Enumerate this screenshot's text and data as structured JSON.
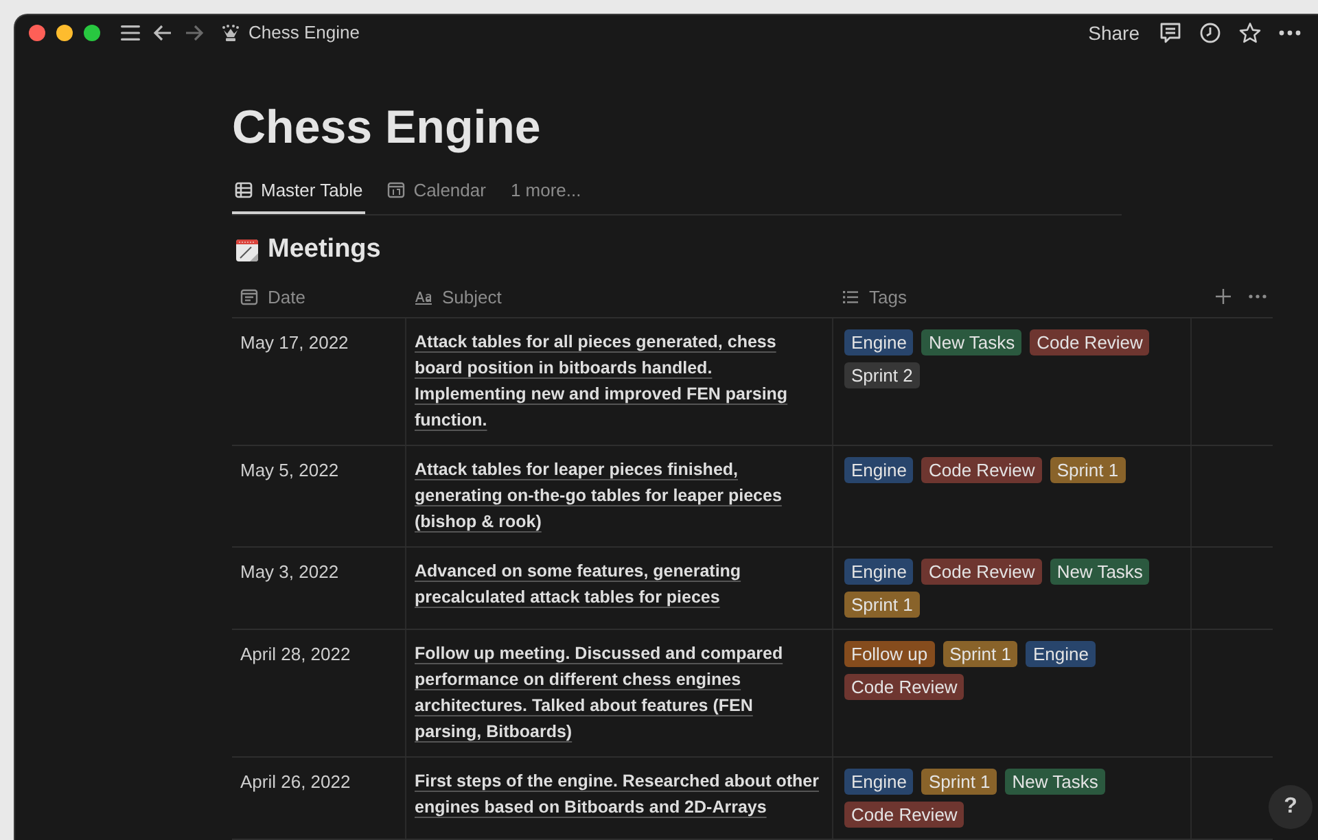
{
  "window": {
    "title": "Chess Engine",
    "actions": [
      "Share"
    ]
  },
  "page": {
    "title": "Chess Engine"
  },
  "views": [
    {
      "label": "Master Table",
      "selected": true
    },
    {
      "label": "Calendar",
      "selected": false
    },
    {
      "label": "1 more...",
      "selected": false
    }
  ],
  "database": {
    "title": "Meetings",
    "columns": [
      {
        "label": "Date"
      },
      {
        "label": "Subject"
      },
      {
        "label": "Tags"
      }
    ],
    "rows": [
      {
        "date": "May 17, 2022",
        "subject": "Attack tables for all pieces generated, chess board position in bitboards handled. Implementing new and improved FEN parsing function.",
        "tags": [
          {
            "label": "Engine",
            "color": "#28456c"
          },
          {
            "label": "New Tasks",
            "color": "#2b593f"
          },
          {
            "label": "Code Review",
            "color": "#6e3630"
          },
          {
            "label": "Sprint 2",
            "color": "#373737"
          }
        ]
      },
      {
        "date": "May 5, 2022",
        "subject": "Attack tables for leaper pieces finished, generating on-the-go tables for leaper pieces (bishop & rook)",
        "tags": [
          {
            "label": "Engine",
            "color": "#28456c"
          },
          {
            "label": "Code Review",
            "color": "#6e3630"
          },
          {
            "label": "Sprint 1",
            "color": "#89632a"
          }
        ]
      },
      {
        "date": "May 3, 2022",
        "subject": "Advanced on some features, generating precalculated attack tables for pieces",
        "tags": [
          {
            "label": "Engine",
            "color": "#28456c"
          },
          {
            "label": "Code Review",
            "color": "#6e3630"
          },
          {
            "label": "New Tasks",
            "color": "#2b593f"
          },
          {
            "label": "Sprint 1",
            "color": "#89632a"
          }
        ]
      },
      {
        "date": "April 28, 2022",
        "subject": "Follow up meeting. Discussed and compared performance on different chess engines architectures. Talked about features (FEN parsing, Bitboards)",
        "tags": [
          {
            "label": "Follow up",
            "color": "#854c1d"
          },
          {
            "label": "Sprint 1",
            "color": "#89632a"
          },
          {
            "label": "Engine",
            "color": "#28456c"
          },
          {
            "label": "Code Review",
            "color": "#6e3630"
          }
        ]
      },
      {
        "date": "April 26, 2022",
        "subject": "First steps of the engine. Researched about other engines based on Bitboards and 2D-Arrays",
        "tags": [
          {
            "label": "Engine",
            "color": "#28456c"
          },
          {
            "label": "Sprint 1",
            "color": "#89632a"
          },
          {
            "label": "New Tasks",
            "color": "#2b593f"
          },
          {
            "label": "Code Review",
            "color": "#6e3630"
          }
        ]
      }
    ]
  },
  "help": {
    "label": "?"
  }
}
